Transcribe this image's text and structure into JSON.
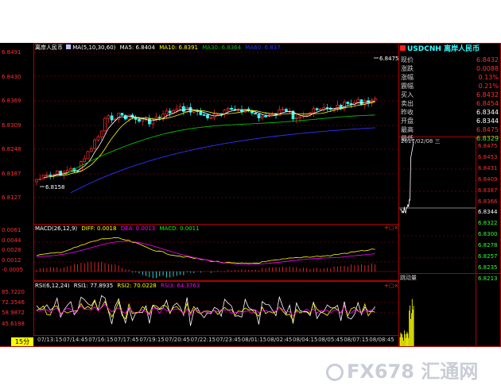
{
  "price_panel": {
    "symbol": "离岸人民币",
    "ma_periods": "MA(5,10,30,60)",
    "ma5": "MA5: 6.8404",
    "ma10": "MA10: 6.8391",
    "ma30": "MA30: 6.8364",
    "ma60": "MA60: 6.837",
    "y_ticks": [
      "6.8491",
      "6.8430",
      "6.8369",
      "6.8309",
      "6.8248",
      "6.8187",
      "6.8127"
    ],
    "high_marker": "6.8475",
    "low_marker": "6.8158"
  },
  "macd_panel": {
    "title": "MACD(26,12,9)",
    "diff": "DIFF: 0.0018",
    "dea": "DEA: 0.0013",
    "macd": "MACD: 0.0011",
    "y_ticks": [
      "0.0061",
      "0.0044",
      "0.0028",
      "0.0012",
      "-0.0005"
    ]
  },
  "rsi_panel": {
    "title": "RSI(6,12,24)",
    "rsi1": "RSI1: 77.8935",
    "rsi2": "RSI2: 70.0228",
    "rsi3": "RSI3: 64.3763",
    "y_ticks": [
      "85.7220",
      "72.3546",
      "58.9872",
      "45.6198"
    ]
  },
  "x_ticks": [
    "07/13:15",
    "07/14:45",
    "07/16:15",
    "07/17:45",
    "07/19:15",
    "07/20:45",
    "07/22:15",
    "07/23:45",
    "08/01:15",
    "08/02:45",
    "08/04:15",
    "08/05:45",
    "08/07:15",
    "08/08:45"
  ],
  "period_button": "15分",
  "quote": {
    "symbol": "USDCNH",
    "name": "离岸人民币",
    "rows": [
      {
        "label": "现价",
        "value": "6.8432",
        "color": "#ff3030"
      },
      {
        "label": "涨跌",
        "value": "0.0088",
        "color": "#ff3030"
      },
      {
        "label": "涨幅",
        "value": "0.13%",
        "color": "#ff3030"
      },
      {
        "label": "震幅",
        "value": "0.21%",
        "color": "#ff3030"
      },
      {
        "label": "买入",
        "value": "6.8432",
        "color": "#ff3030"
      },
      {
        "label": "卖出",
        "value": "6.8454",
        "color": "#ff3030"
      },
      {
        "label": "昨收",
        "value": "6.8344",
        "color": "#ffffff"
      },
      {
        "label": "开盘",
        "value": "6.8344",
        "color": "#ffffff"
      },
      {
        "label": "最高",
        "value": "6.8475",
        "color": "#ff3030"
      },
      {
        "label": "最低",
        "value": "6.8329",
        "color": "#30ff30"
      }
    ]
  },
  "intraday": {
    "date_label": "2017/02/08 三",
    "y_ticks": [
      "6.8475",
      "6.8453",
      "6.8431",
      "6.8409",
      "6.8387",
      "6.8366",
      "6.8344",
      "6.8322",
      "6.8300",
      "6.8278",
      "6.8257",
      "6.8235",
      "6.8213"
    ],
    "volume_label": "跳动量"
  },
  "watermark": {
    "text": "FX678 汇通网"
  },
  "colors": {
    "up": "#ff3030",
    "down": "#30ffff",
    "ma5": "#ffffff",
    "ma10": "#ffff00",
    "ma30": "#00c000",
    "ma60": "#3030ff",
    "axis": "#b00000",
    "dea": "#ff00ff"
  }
}
